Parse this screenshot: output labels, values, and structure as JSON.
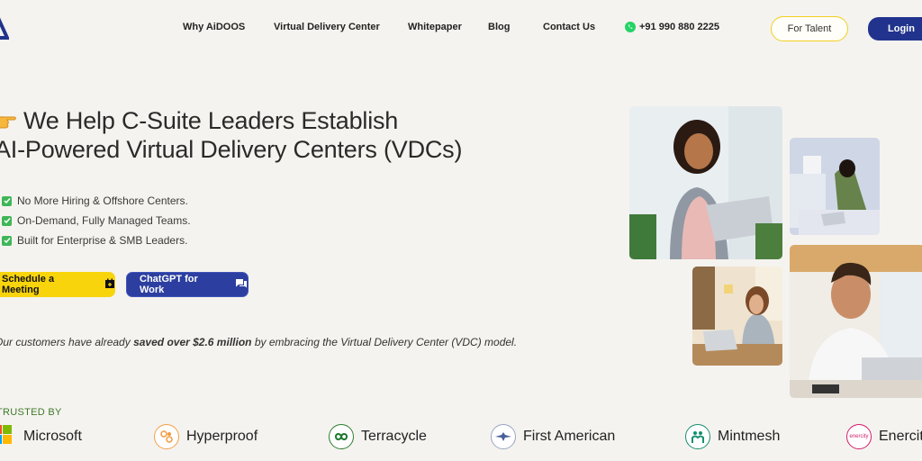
{
  "nav": {
    "links": [
      "Why AiDOOS",
      "Virtual Delivery Center",
      "Whitepaper",
      "Blog",
      "Contact Us"
    ],
    "phone": "+91 990 880 2225",
    "talent_label": "For Talent",
    "login_label": "Login",
    "phone_icon": "whatsapp-icon"
  },
  "hero": {
    "title_line1": "We Help C-Suite Leaders Establish",
    "title_line2": "AI-Powered Virtual Delivery Centers (VDCs)",
    "bullets": [
      "No More Hiring & Offshore Centers.",
      "On-Demand, Fully Managed Teams.",
      "Built for Enterprise & SMB Leaders."
    ],
    "schedule_label": "Schedule a Meeting",
    "chatgpt_label": "ChatGPT for Work",
    "savings_prefix": "Our customers have already",
    "savings_bold": "saved over $2.6 million",
    "savings_suffix": "by embracing the Virtual Delivery Center (VDC) model."
  },
  "trusted": {
    "label": "TRUSTED BY",
    "logos": [
      "Microsoft",
      "Hyperproof",
      "Terracycle",
      "First American",
      "Mintmesh",
      "Enercity"
    ],
    "enercity_badge": "enercity"
  },
  "colors": {
    "accent_yellow": "#f8d40c",
    "brand_blue": "#21338d",
    "background": "#f5f3ef"
  }
}
